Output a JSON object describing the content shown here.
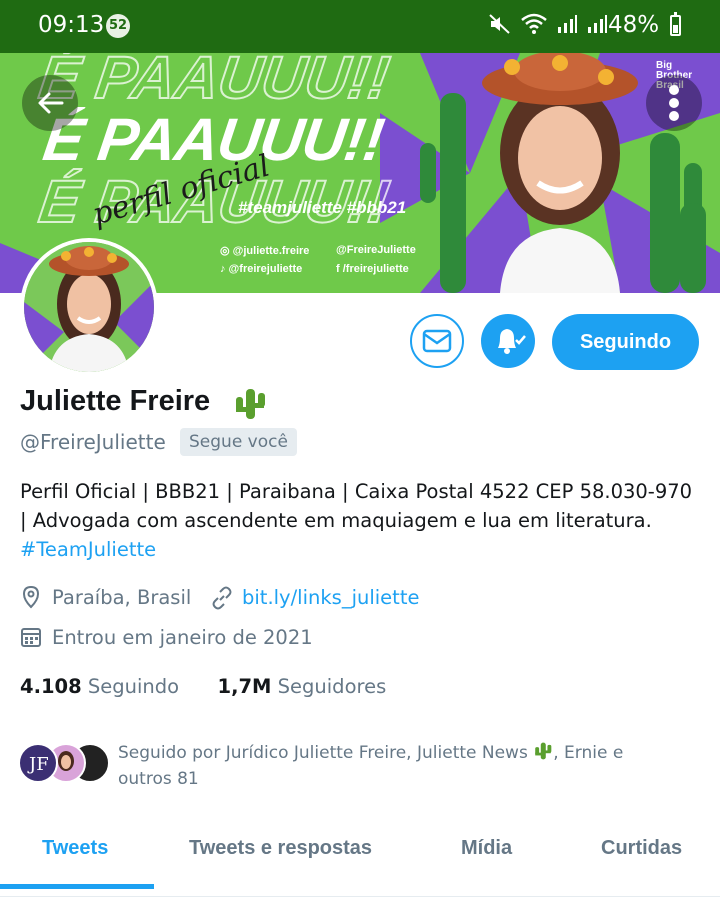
{
  "status_bar": {
    "time": "09:13",
    "notification_count": "52",
    "battery": "48%"
  },
  "banner": {
    "headline": "É PAAUUU!!",
    "script_text": "perfil oficial",
    "hashtags": "#teamjuliette   #bbb21",
    "social_1": "◎ @juliette.freire",
    "social_2": "@FreireJuliette",
    "social_3": "♪ @freirejuliette",
    "social_4": "f /freirejuliette",
    "logo": "Big Brother Brasil"
  },
  "profile": {
    "name": "Juliette Freire",
    "handle": "@FreireJuliette",
    "follows_you": "Segue você",
    "bio_line1": "Perfil Oficial | BBB21 | Paraibana | Caixa Postal 4522 CEP 58.030-970",
    "bio_line2": "| Advogada com ascendente em maquiagem e lua em literatura.",
    "bio_hashtag": "#TeamJuliette",
    "location": "Paraíba, Brasil",
    "website": "bit.ly/links_juliette",
    "joined": "Entrou em janeiro de 2021",
    "following_count": "4.108",
    "following_label": "Seguindo",
    "followers_count": "1,7M",
    "followers_label": "Seguidores",
    "followed_by_a": "Seguido por Jurídico Juliette Freire, Juliette News",
    "followed_by_b": ", Ernie e",
    "followed_by_c": "outros 81"
  },
  "actions": {
    "follow_label": "Seguindo"
  },
  "tabs": [
    "Tweets",
    "Tweets e respostas",
    "Mídia",
    "Curtidas"
  ],
  "colors": {
    "accent": "#1da1f2",
    "status_bar": "#1f6b12",
    "banner_green": "#6fc94a",
    "banner_purple": "#7b4fd0"
  }
}
